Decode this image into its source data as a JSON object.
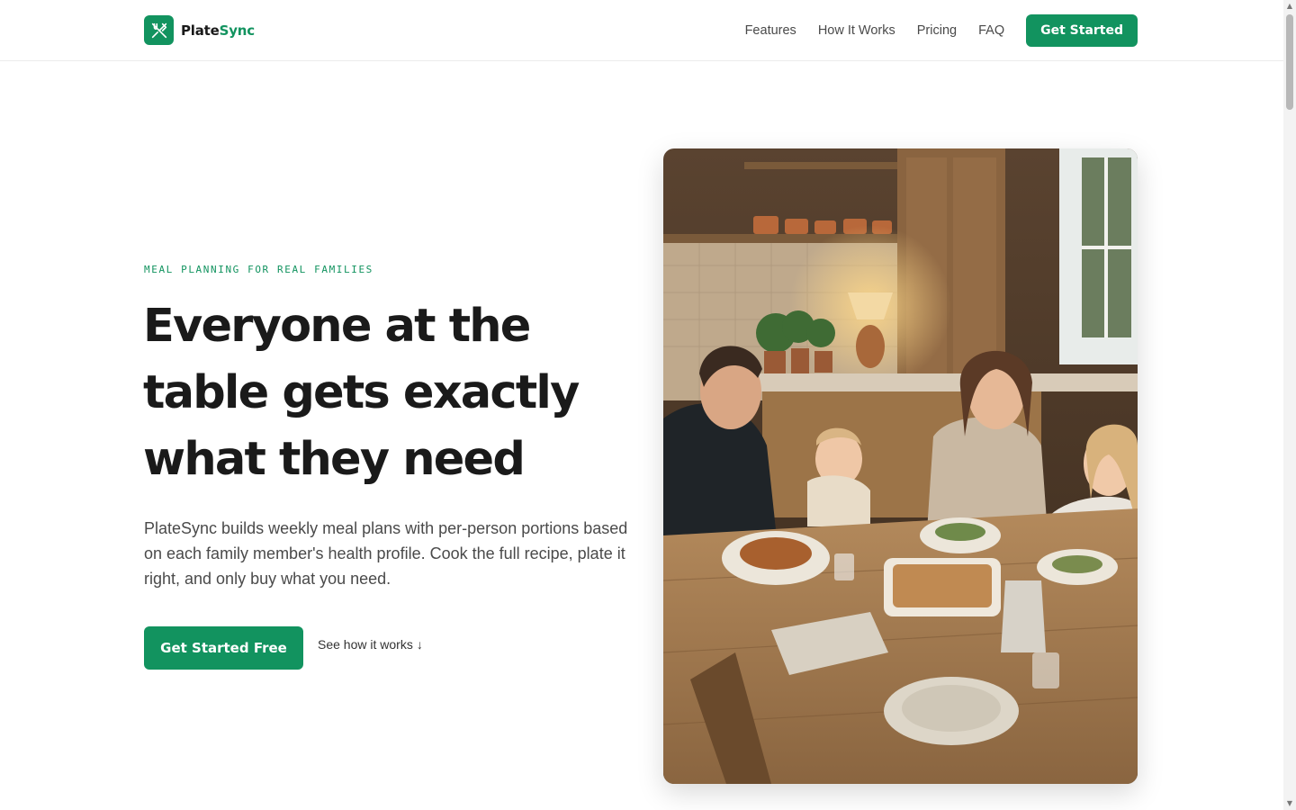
{
  "brand": {
    "name_part1": "Plate",
    "name_part2": "Sync",
    "logo_icon": "utensils-crossed-icon",
    "accent_color": "#12935f"
  },
  "nav": {
    "links": [
      "Features",
      "How It Works",
      "Pricing",
      "FAQ"
    ],
    "cta_label": "Get Started"
  },
  "hero": {
    "eyebrow": "MEAL PLANNING FOR REAL FAMILIES",
    "headline": "Everyone at the table gets exactly what they need",
    "description": "PlateSync builds weekly meal plans with per-person portions based on each family member's health profile. Cook the full recipe, plate it right, and only buy what you need.",
    "primary_cta": "Get Started Free",
    "secondary_cta": "See how it works",
    "secondary_cta_icon": "arrow-down-icon"
  }
}
